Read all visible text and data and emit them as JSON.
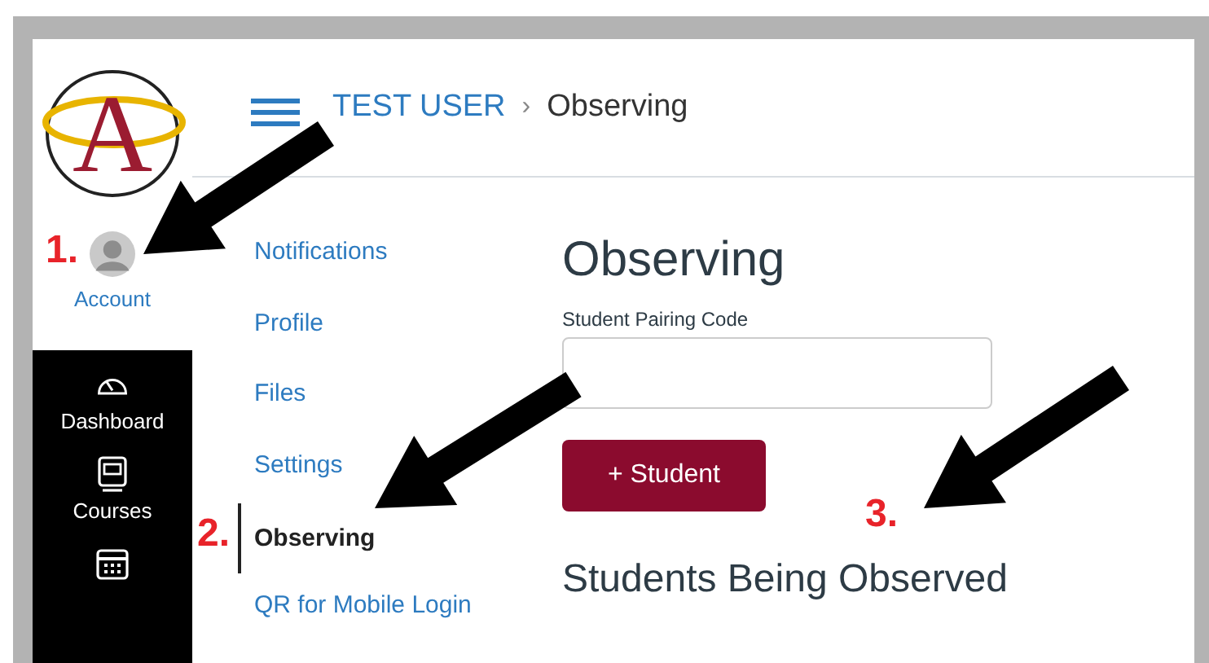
{
  "logo": {
    "letter": "A"
  },
  "global_nav": {
    "account": {
      "label": "Account"
    },
    "items": [
      {
        "kind": "dashboard",
        "label": "Dashboard"
      },
      {
        "kind": "courses",
        "label": "Courses"
      },
      {
        "kind": "calendar"
      }
    ]
  },
  "breadcrumb": {
    "items": [
      "TEST USER",
      "Observing"
    ],
    "separator": "›"
  },
  "sub_nav": {
    "items": [
      {
        "label": "Notifications",
        "selected": false
      },
      {
        "label": "Profile",
        "selected": false
      },
      {
        "label": "Files",
        "selected": false
      },
      {
        "label": "Settings",
        "selected": false
      },
      {
        "label": "Observing",
        "selected": true
      },
      {
        "label": "QR for Mobile Login",
        "selected": false
      }
    ]
  },
  "content": {
    "title": "Observing",
    "field_label": "Student Pairing Code",
    "button": "+ Student",
    "section_title": "Students Being Observed"
  },
  "annotations": [
    {
      "label": "1."
    },
    {
      "label": "2."
    },
    {
      "label": "3."
    }
  ]
}
